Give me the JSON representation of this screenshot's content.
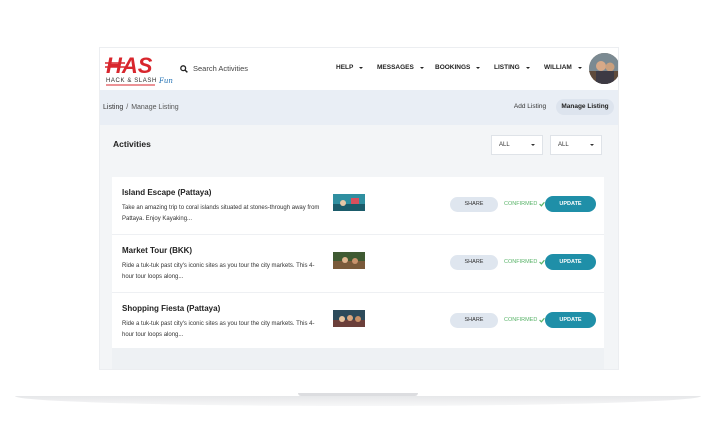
{
  "header": {
    "logo_text": "HAS",
    "logo_sub": "HACK & SLASH",
    "logo_script": "Fun",
    "search_placeholder": "Search Activities",
    "nav": [
      {
        "label": "HELP"
      },
      {
        "label": "MESSAGES"
      },
      {
        "label": "BOOKINGS"
      },
      {
        "label": "LISTING"
      },
      {
        "label": "WILLIAM"
      }
    ]
  },
  "breadcrumb": {
    "root": "Listing",
    "separator": "/",
    "current": "Manage Listing"
  },
  "subtabs": {
    "add": "Add Listing",
    "manage": "Manage Listing"
  },
  "panel": {
    "title": "Activities",
    "filter1": "ALL",
    "filter2": "ALL"
  },
  "listings": [
    {
      "title": "Island Escape (Pattaya)",
      "desc": "Take an amazing trip to coral islands situated at stones-through away from Pattaya. Enjoy Kayaking...",
      "share": "SHARE",
      "status": "CONFIRMED",
      "update": "UPDATE"
    },
    {
      "title": "Market Tour (BKK)",
      "desc": "Ride a tuk-tuk past city's iconic sites as you tour the city markets. This 4-hour tour loops along...",
      "share": "SHARE",
      "status": "CONFIRMED",
      "update": "UPDATE"
    },
    {
      "title": "Shopping Fiesta (Pattaya)",
      "desc": "Ride a tuk-tuk past city's iconic sites as you tour the city markets. This 4-hour tour loops along...",
      "share": "SHARE",
      "status": "CONFIRMED",
      "update": "UPDATE"
    }
  ],
  "colors": {
    "accent": "#1f8fa8",
    "confirmed": "#58b368",
    "logo_red": "#d8262d"
  },
  "icons": {
    "search": "search-icon",
    "dropdown": "chevron-down-icon",
    "check": "check-icon"
  }
}
